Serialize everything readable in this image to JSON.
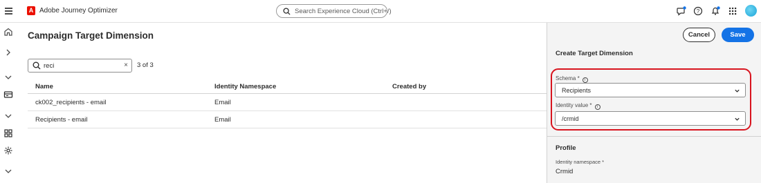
{
  "app": {
    "name": "Adobe Journey Optimizer",
    "logo_letter": "A",
    "brand_color": "#eb1000"
  },
  "topbar": {
    "search_placeholder": "Search Experience Cloud (Ctrl+/)",
    "icons": [
      "help-chat-icon",
      "help-icon",
      "notifications-icon",
      "apps-grid-icon",
      "avatar"
    ]
  },
  "rail": {
    "icons": [
      "menu-icon",
      "home-icon",
      "expand-icon",
      "chevron-down-icon",
      "campaign-icon",
      "chevron-down-icon",
      "grid-icon",
      "settings-icon",
      "chevron-down-icon"
    ]
  },
  "main": {
    "title": "Campaign Target Dimension",
    "filter": {
      "value": "reci",
      "clear": "×"
    },
    "result_count": "3 of 3",
    "columns": [
      "Name",
      "Identity Namespace",
      "Created by"
    ],
    "rows": [
      {
        "name": "ck002_recipients - email",
        "namespace": "Email",
        "created_by": ""
      },
      {
        "name": "Recipients - email",
        "namespace": "Email",
        "created_by": ""
      }
    ]
  },
  "panel": {
    "cancel_label": "Cancel",
    "save_label": "Save",
    "title": "Create Target Dimension",
    "schema": {
      "label": "Schema",
      "required": "*",
      "value": "Recipients"
    },
    "identity": {
      "label": "Identity value",
      "required": "*",
      "value": "/crmid"
    },
    "profile": {
      "title": "Profile",
      "namespace_label": "Identity namespace *",
      "namespace_value": "Crmid"
    },
    "accent_color": "#1473e6",
    "highlight_color": "#d8141e"
  }
}
